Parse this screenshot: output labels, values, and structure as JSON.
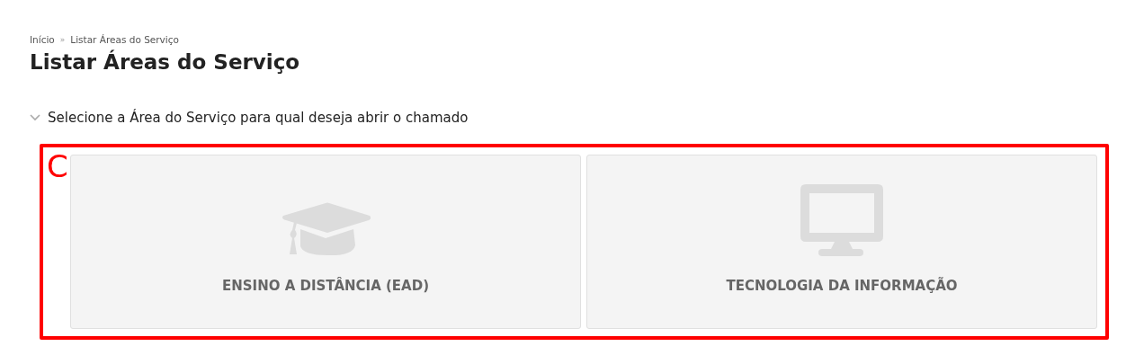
{
  "breadcrumb": [
    {
      "label": "Início"
    },
    {
      "label": "Listar Áreas do Serviço"
    }
  ],
  "breadcrumb_separator": "»",
  "title": "Listar Áreas do Serviço",
  "section": {
    "label": "Selecione a Área do Serviço para qual deseja abrir o chamado",
    "expanded": true
  },
  "annotation": {
    "label": "C"
  },
  "areas": [
    {
      "kind": "graduation-cap",
      "label": "ENSINO A DISTÂNCIA (EAD)"
    },
    {
      "kind": "monitor",
      "label": "TECNOLOGIA DA INFORMAÇÃO"
    }
  ]
}
